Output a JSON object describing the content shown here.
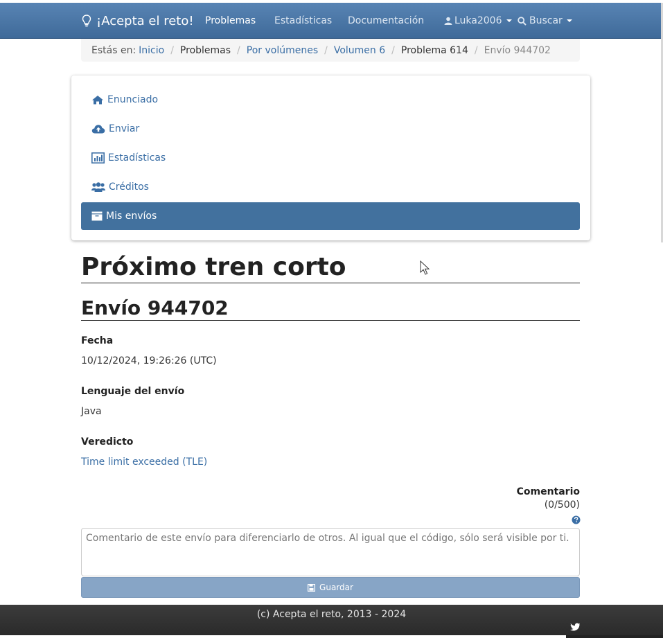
{
  "navbar": {
    "brand": "¡Acepta el reto!",
    "links": [
      "Problemas",
      "Estadísticas",
      "Documentación"
    ],
    "user": "Luka2006",
    "search": "Buscar"
  },
  "breadcrumb": {
    "prefix": "Estás en:",
    "items": [
      "Inicio",
      "Problemas",
      "Por volúmenes",
      "Volumen 6",
      "Problema 614",
      "Envío 944702"
    ]
  },
  "menu": {
    "items": [
      "Enunciado",
      "Enviar",
      "Estadísticas",
      "Créditos",
      "Mis envíos"
    ],
    "active": "Mis envíos"
  },
  "problem": {
    "title": "Próximo tren corto",
    "submission": "Envío 944702"
  },
  "fields": {
    "date_label": "Fecha",
    "date_value": "10/12/2024, 19:26:26 (UTC)",
    "language_label": "Lenguaje del envío",
    "language_value": "Java",
    "verdict_label": "Veredicto",
    "verdict_value": "Time limit exceeded (TLE)"
  },
  "comment": {
    "label": "Comentario",
    "counter": "(0/500)",
    "placeholder": "Comentario de este envío para diferenciarlo de otros.  Al igual que el código, sólo será visible por ti.",
    "save": "Guardar"
  },
  "footer": {
    "text": "(c) Acepta el reto, 2013 - 2024"
  },
  "colors": {
    "navbar": "#4a77a8",
    "accent": "#42719e",
    "link": "#3a6ea5",
    "footer": "#333333"
  }
}
